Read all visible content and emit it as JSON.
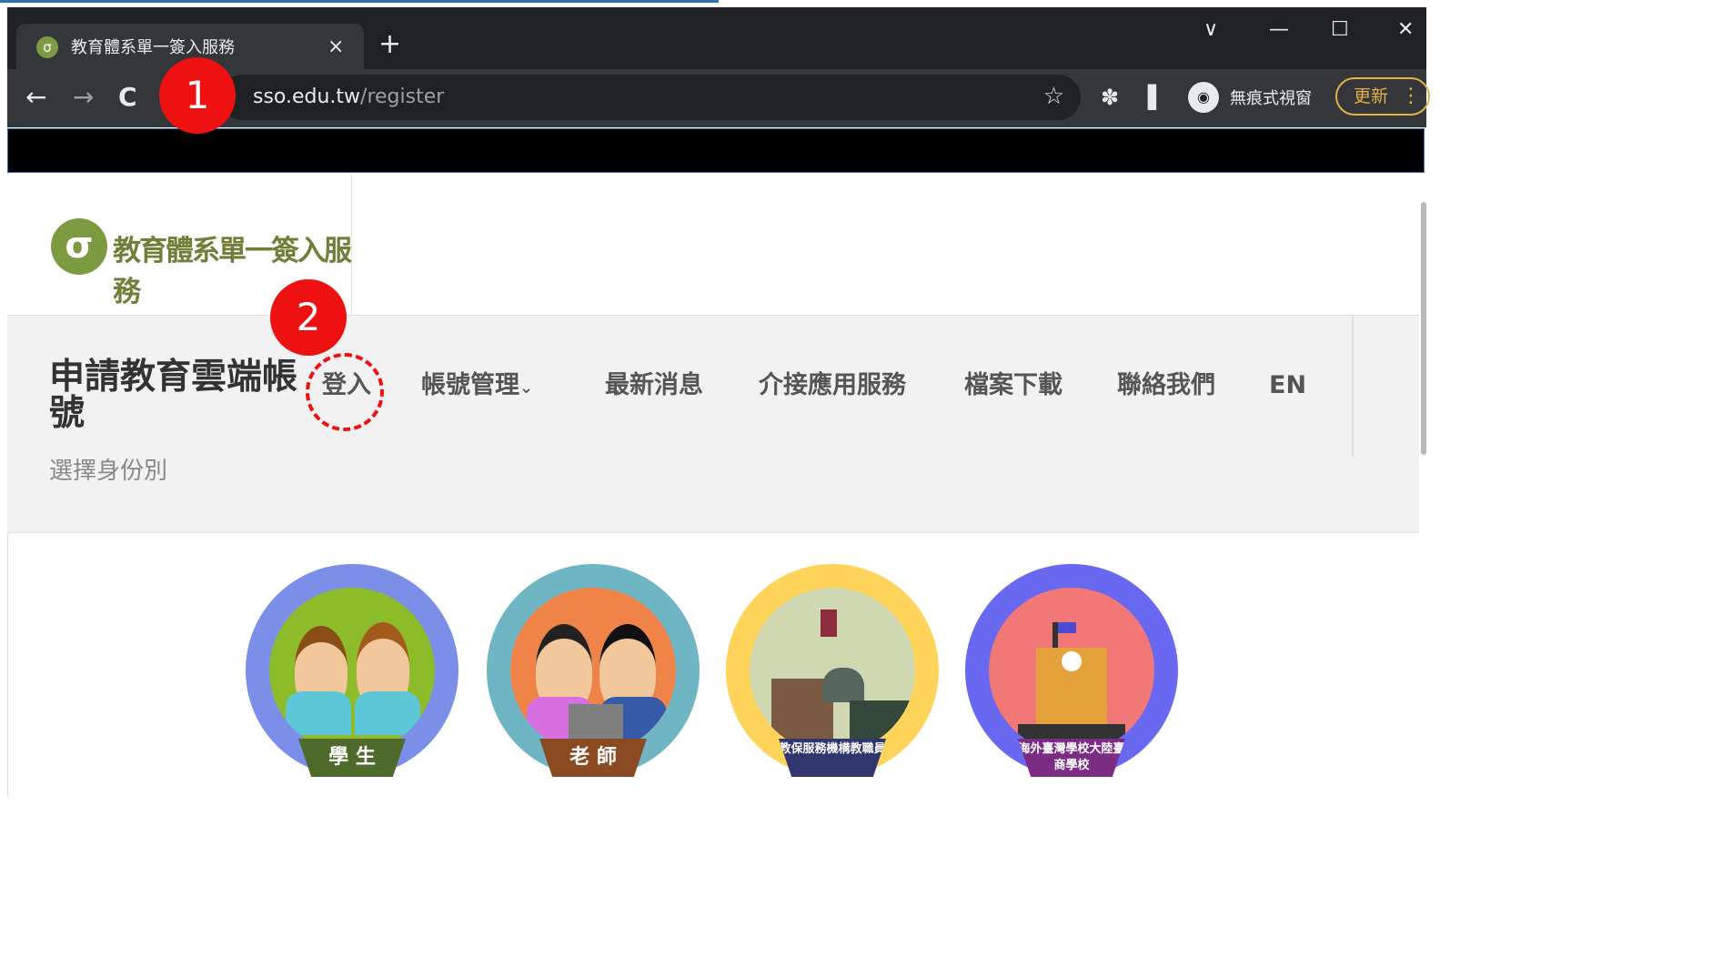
{
  "browser": {
    "tab_title": "教育體系單一簽入服務",
    "tab_favicon": "σ",
    "tab_close": "×",
    "new_tab": "+",
    "window_controls": {
      "chevron": "∨",
      "minimize": "—",
      "maximize": "☐",
      "close": "✕"
    },
    "nav": {
      "back": "←",
      "forward": "→",
      "reload": "C"
    },
    "url_host": "sso.edu.tw",
    "url_path": "/register",
    "bookmark_icon": "☆",
    "extensions_icon": "✽",
    "sidepanel_icon": "▌",
    "incognito_label": "無痕式視窗",
    "incognito_icon": "◉",
    "update_label": "更新",
    "update_menu": "⋮"
  },
  "site": {
    "logo_mark": "σ",
    "logo_text": "教育體系單一簽入服務",
    "page_title": "申請教育雲端帳號",
    "page_subtitle": "選擇身份別",
    "nav": [
      {
        "label": "登入"
      },
      {
        "label": "帳號管理",
        "caret": "⌄"
      },
      {
        "label": "最新消息"
      },
      {
        "label": "介接應用服務"
      },
      {
        "label": "檔案下載"
      },
      {
        "label": "聯絡我們"
      },
      {
        "label": "EN"
      }
    ],
    "identities": [
      {
        "label": "學 生",
        "ring": "#7b8ee8",
        "fill": "#8dbb2a",
        "ribbon": "#4f6b2c"
      },
      {
        "label": "老 師",
        "ring": "#6fb5c4",
        "fill": "#f08348",
        "ribbon": "#8b4b22"
      },
      {
        "label": "教保服務機構教職員",
        "ring": "#ffd45b",
        "fill": "#cfd8b0",
        "ribbon": "#32366e"
      },
      {
        "label": "海外臺灣學校大陸臺商學校",
        "ring": "#6868f0",
        "fill": "#f27777",
        "ribbon": "#7a2d83"
      }
    ]
  },
  "annotations": {
    "marker1": "1",
    "marker2": "2",
    "color": "#ee1111"
  }
}
